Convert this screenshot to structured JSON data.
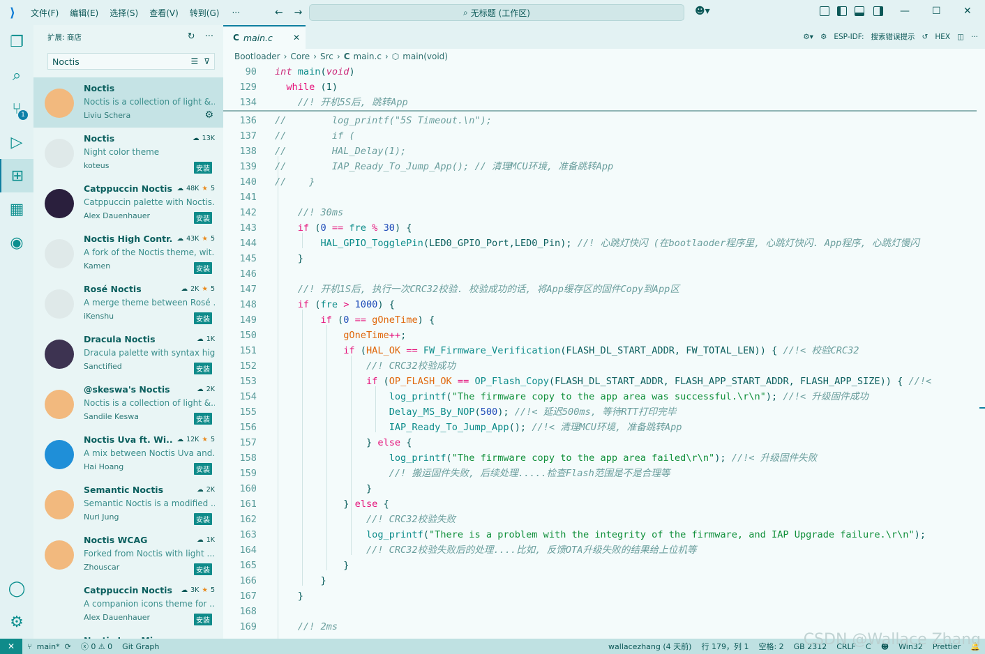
{
  "titlebar": {
    "menus": [
      "文件(F)",
      "编辑(E)",
      "选择(S)",
      "查看(V)",
      "转到(G)"
    ],
    "more": "···",
    "search_text": "无标题 (工作区)"
  },
  "sidebar": {
    "title": "扩展: 商店",
    "search_value": "Noctis",
    "extensions": [
      {
        "name": "Noctis",
        "desc": "Noctis is a collection of light &...",
        "author": "Liviu Schera",
        "downloads": "",
        "stars": "",
        "installed": true,
        "icon_color": "#f2b97e"
      },
      {
        "name": "Noctis",
        "desc": "Night color theme",
        "author": "koteus",
        "downloads": "13K",
        "stars": "",
        "install_label": "安装",
        "icon_color": "#dfe9e9"
      },
      {
        "name": "Catppuccin Noctis",
        "desc": "Catppuccin palette with Noctis...",
        "author": "Alex Dauenhauer",
        "downloads": "48K",
        "stars": "5",
        "install_label": "安装",
        "icon_color": "#2a1f3d"
      },
      {
        "name": "Noctis High Contr...",
        "desc": "A fork of the Noctis theme, wit...",
        "author": "Kamen",
        "downloads": "43K",
        "stars": "5",
        "install_label": "安装",
        "icon_color": "#dfe9e9"
      },
      {
        "name": "Rosé Noctis",
        "desc": "A merge theme between Rosé ...",
        "author": "iKenshu",
        "downloads": "2K",
        "stars": "5",
        "install_label": "安装",
        "icon_color": "#dfe9e9"
      },
      {
        "name": "Dracula Noctis",
        "desc": "Dracula palette with syntax hig...",
        "author": "Sanctified",
        "downloads": "1K",
        "stars": "",
        "install_label": "安装",
        "icon_color": "#3d3351"
      },
      {
        "name": "@skeswa's Noctis",
        "desc": "Noctis is a collection of light &...",
        "author": "Sandile Keswa",
        "downloads": "2K",
        "stars": "",
        "install_label": "安装",
        "icon_color": "#f2b97e"
      },
      {
        "name": "Noctis Uva ft. Wi...",
        "desc": "A mix between Noctis Uva and...",
        "author": "Hai Hoang",
        "downloads": "12K",
        "stars": "5",
        "install_label": "安装",
        "icon_color": "#1f8fd8"
      },
      {
        "name": "Semantic Noctis",
        "desc": "Semantic Noctis is a modified ...",
        "author": "Nuri Jung",
        "downloads": "2K",
        "stars": "",
        "install_label": "安装",
        "icon_color": "#f2b97e"
      },
      {
        "name": "Noctis WCAG",
        "desc": "Forked from Noctis with light ...",
        "author": "Zhouscar",
        "downloads": "1K",
        "stars": "",
        "install_label": "安装",
        "icon_color": "#f2b97e"
      },
      {
        "name": "Catppuccin Noctis ...",
        "desc": "A companion icons theme for ...",
        "author": "Alex Dauenhauer",
        "downloads": "3K",
        "stars": "5",
        "install_label": "安装",
        "icon_color": "#e9f5f5"
      },
      {
        "name": "Noctis Icon Mi...",
        "desc": "",
        "author": "",
        "downloads": "",
        "stars": "",
        "install_label": "",
        "icon_color": "#f2b97e"
      }
    ]
  },
  "editor": {
    "tab_label": "main.c",
    "tab_lang": "C",
    "actions": {
      "esp": "ESP-IDF:",
      "search_label": "搜索错误提示",
      "hex": "HEX"
    },
    "breadcrumb": [
      "Bootloader",
      "Core",
      "Src",
      "main.c",
      "main(void)"
    ],
    "sticky": [
      {
        "n": "90",
        "code": [
          [
            "int",
            "ty"
          ],
          [
            " ",
            "pl"
          ],
          [
            "main",
            "fn"
          ],
          [
            "(",
            "pl"
          ],
          [
            "void",
            "ty"
          ],
          [
            ")",
            "pl"
          ]
        ]
      },
      {
        "n": "129",
        "code": [
          [
            "  while",
            "kw"
          ],
          [
            " (1)",
            "pl"
          ]
        ]
      },
      {
        "n": "134",
        "code": [
          [
            "    //! 开机5S后, 跳转App",
            "cm"
          ]
        ]
      }
    ],
    "lines": [
      {
        "n": "136",
        "code": [
          [
            "//        log_printf(\"5S Timeout.\\n\");",
            "cm"
          ]
        ]
      },
      {
        "n": "137",
        "code": [
          [
            "//        if (",
            "cm"
          ]
        ]
      },
      {
        "n": "138",
        "code": [
          [
            "//        HAL_Delay(1);",
            "cm"
          ]
        ]
      },
      {
        "n": "139",
        "code": [
          [
            "//        IAP_Ready_To_Jump_App(); // 清理MCU环境, 准备跳转App",
            "cm"
          ]
        ]
      },
      {
        "n": "140",
        "code": [
          [
            "//    }",
            "cm"
          ]
        ]
      },
      {
        "n": "141",
        "code": []
      },
      {
        "n": "142",
        "code": [
          [
            "    //! 30ms",
            "cm"
          ]
        ]
      },
      {
        "n": "143",
        "code": [
          [
            "    ",
            "pl"
          ],
          [
            "if",
            "kw"
          ],
          [
            " (",
            "pl"
          ],
          [
            "0",
            "nm"
          ],
          [
            " == ",
            "op"
          ],
          [
            "fre",
            "fn"
          ],
          [
            " % ",
            "op"
          ],
          [
            "30",
            "nm"
          ],
          [
            ") {",
            "pl"
          ]
        ]
      },
      {
        "n": "144",
        "code": [
          [
            "        ",
            "pl"
          ],
          [
            "HAL_GPIO_TogglePin",
            "fn"
          ],
          [
            "(LED0_GPIO_Port,LED0_Pin); ",
            "pl"
          ],
          [
            "//! 心跳灯快闪 (在bootlaoder程序里, 心跳灯快闪. App程序, 心跳灯慢闪",
            "cm"
          ]
        ]
      },
      {
        "n": "145",
        "code": [
          [
            "    }",
            "pl"
          ]
        ]
      },
      {
        "n": "146",
        "code": []
      },
      {
        "n": "147",
        "code": [
          [
            "    //! 开机1S后, 执行一次CRC32校验. 校验成功的话, 将App缓存区的固件Copy到App区",
            "cm"
          ]
        ]
      },
      {
        "n": "148",
        "code": [
          [
            "    ",
            "pl"
          ],
          [
            "if",
            "kw"
          ],
          [
            " (",
            "pl"
          ],
          [
            "fre",
            "fn"
          ],
          [
            " > ",
            "op"
          ],
          [
            "1000",
            "nm"
          ],
          [
            ") {",
            "pl"
          ]
        ]
      },
      {
        "n": "149",
        "code": [
          [
            "        ",
            "pl"
          ],
          [
            "if",
            "kw"
          ],
          [
            " (",
            "pl"
          ],
          [
            "0",
            "nm"
          ],
          [
            " == ",
            "op"
          ],
          [
            "gOneTime",
            "vr"
          ],
          [
            ") {",
            "pl"
          ]
        ]
      },
      {
        "n": "150",
        "code": [
          [
            "            ",
            "pl"
          ],
          [
            "gOneTime",
            "vr"
          ],
          [
            "++",
            "op"
          ],
          [
            ";",
            "pl"
          ]
        ]
      },
      {
        "n": "151",
        "code": [
          [
            "            ",
            "pl"
          ],
          [
            "if",
            "kw"
          ],
          [
            " (",
            "pl"
          ],
          [
            "HAL_OK",
            "vr"
          ],
          [
            " == ",
            "op"
          ],
          [
            "FW_Firmware_Verification",
            "fn"
          ],
          [
            "(FLASH_DL_START_ADDR, FW_TOTAL_LEN)) { ",
            "pl"
          ],
          [
            "//!< 校验CRC32",
            "cm"
          ]
        ]
      },
      {
        "n": "152",
        "code": [
          [
            "                //! CRC32校验成功",
            "cm"
          ]
        ]
      },
      {
        "n": "153",
        "code": [
          [
            "                ",
            "pl"
          ],
          [
            "if",
            "kw"
          ],
          [
            " (",
            "pl"
          ],
          [
            "OP_FLASH_OK",
            "vr"
          ],
          [
            " == ",
            "op"
          ],
          [
            "OP_Flash_Copy",
            "fn"
          ],
          [
            "(FLASH_DL_START_ADDR, FLASH_APP_START_ADDR, FLASH_APP_SIZE)) { ",
            "pl"
          ],
          [
            "//!<",
            "cm"
          ]
        ]
      },
      {
        "n": "154",
        "code": [
          [
            "                    ",
            "pl"
          ],
          [
            "log_printf",
            "fn"
          ],
          [
            "(",
            "pl"
          ],
          [
            "\"The firmware copy to the app area was successful.\\r\\n\"",
            "st"
          ],
          [
            "); ",
            "pl"
          ],
          [
            "//!< 升级固件成功",
            "cm"
          ]
        ]
      },
      {
        "n": "155",
        "code": [
          [
            "                    ",
            "pl"
          ],
          [
            "Delay_MS_By_NOP",
            "fn"
          ],
          [
            "(",
            "pl"
          ],
          [
            "500",
            "nm"
          ],
          [
            "); ",
            "pl"
          ],
          [
            "//!< 延迟500ms, 等待RTT打印完毕",
            "cm"
          ]
        ]
      },
      {
        "n": "156",
        "code": [
          [
            "                    ",
            "pl"
          ],
          [
            "IAP_Ready_To_Jump_App",
            "fn"
          ],
          [
            "(); ",
            "pl"
          ],
          [
            "//!< 清理MCU环境, 准备跳转App",
            "cm"
          ]
        ]
      },
      {
        "n": "157",
        "code": [
          [
            "                } ",
            "pl"
          ],
          [
            "else",
            "kw"
          ],
          [
            " {",
            "pl"
          ]
        ]
      },
      {
        "n": "158",
        "code": [
          [
            "                    ",
            "pl"
          ],
          [
            "log_printf",
            "fn"
          ],
          [
            "(",
            "pl"
          ],
          [
            "\"The firmware copy to the app area failed\\r\\n\"",
            "st"
          ],
          [
            "); ",
            "pl"
          ],
          [
            "//!< 升级固件失败",
            "cm"
          ]
        ]
      },
      {
        "n": "159",
        "code": [
          [
            "                    //! 搬运固件失败, 后续处理.....检查Flash范围是不是合理等",
            "cm"
          ]
        ]
      },
      {
        "n": "160",
        "code": [
          [
            "                }",
            "pl"
          ]
        ]
      },
      {
        "n": "161",
        "code": [
          [
            "            } ",
            "pl"
          ],
          [
            "else",
            "kw"
          ],
          [
            " {",
            "pl"
          ]
        ]
      },
      {
        "n": "162",
        "code": [
          [
            "                //! CRC32校验失败",
            "cm"
          ]
        ]
      },
      {
        "n": "163",
        "code": [
          [
            "                ",
            "pl"
          ],
          [
            "log_printf",
            "fn"
          ],
          [
            "(",
            "pl"
          ],
          [
            "\"There is a problem with the integrity of the firmware, and IAP Upgrade failure.\\r\\n\"",
            "st"
          ],
          [
            ");",
            "pl"
          ]
        ]
      },
      {
        "n": "164",
        "code": [
          [
            "                //! CRC32校验失败后的处理....比如, 反馈OTA升级失败的结果给上位机等",
            "cm"
          ]
        ]
      },
      {
        "n": "165",
        "code": [
          [
            "            }",
            "pl"
          ]
        ]
      },
      {
        "n": "166",
        "code": [
          [
            "        }",
            "pl"
          ]
        ]
      },
      {
        "n": "167",
        "code": [
          [
            "    }",
            "pl"
          ]
        ]
      },
      {
        "n": "168",
        "code": []
      },
      {
        "n": "169",
        "code": [
          [
            "    //! 2ms",
            "cm"
          ]
        ]
      }
    ]
  },
  "statusbar": {
    "branch": "main*",
    "errors": "0",
    "warnings": "0",
    "git_graph": "Git Graph",
    "author": "wallacezhang (4 天前)",
    "position": "行 179，列 1",
    "spaces": "空格: 2",
    "encoding": "GB 2312",
    "eol": "CRLF",
    "lang": "C",
    "platform": "Win32",
    "prettier": "Prettier"
  },
  "watermark": "CSDN @Wallace Zhang",
  "colors": {
    "accent": "#0e7fa0",
    "keyword": "#e5127a",
    "function": "#0c8c8a",
    "comment": "#6a9e9d",
    "string": "#0f8f3a",
    "number": "#1d4bb8"
  }
}
